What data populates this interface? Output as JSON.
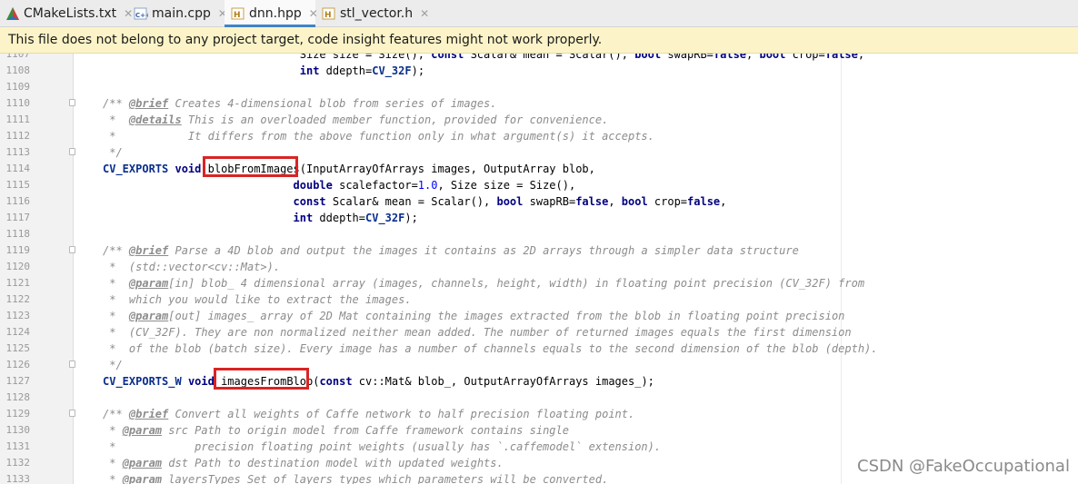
{
  "tabs": [
    {
      "label": "CMakeLists.txt",
      "icon": "cmake-triangle-icon",
      "active": false
    },
    {
      "label": "main.cpp",
      "icon": "cpp-file-icon",
      "active": false
    },
    {
      "label": "dnn.hpp",
      "icon": "header-file-icon",
      "active": true
    },
    {
      "label": "stl_vector.h",
      "icon": "header-file-icon",
      "active": false
    }
  ],
  "banner": {
    "text": "This file does not belong to any project target, code insight features might not work properly."
  },
  "lines": [
    {
      "num": "1107",
      "code": "                              Size size = Size(), const Scalar& mean = Scalar(), bool swapRB=false, bool crop=false,"
    },
    {
      "num": "1108",
      "code": "                              int ddepth=CV_32F);"
    },
    {
      "num": "1109",
      "code": ""
    },
    {
      "num": "1110",
      "code": "/** @brief Creates 4-dimensional blob from series of images."
    },
    {
      "num": "1111",
      "code": " *  @details This is an overloaded member function, provided for convenience."
    },
    {
      "num": "1112",
      "code": " *           It differs from the above function only in what argument(s) it accepts."
    },
    {
      "num": "1113",
      "code": " */"
    },
    {
      "num": "1114",
      "code": "CV_EXPORTS void blobFromImages(InputArrayOfArrays images, OutputArray blob,"
    },
    {
      "num": "1115",
      "code": "                             double scalefactor=1.0, Size size = Size(),"
    },
    {
      "num": "1116",
      "code": "                             const Scalar& mean = Scalar(), bool swapRB=false, bool crop=false,"
    },
    {
      "num": "1117",
      "code": "                             int ddepth=CV_32F);"
    },
    {
      "num": "1118",
      "code": ""
    },
    {
      "num": "1119",
      "code": "/** @brief Parse a 4D blob and output the images it contains as 2D arrays through a simpler data structure"
    },
    {
      "num": "1120",
      "code": " *  (std::vector<cv::Mat>)."
    },
    {
      "num": "1121",
      "code": " *  @param[in] blob_ 4 dimensional array (images, channels, height, width) in floating point precision (CV_32F) from"
    },
    {
      "num": "1122",
      "code": " *  which you would like to extract the images."
    },
    {
      "num": "1123",
      "code": " *  @param[out] images_ array of 2D Mat containing the images extracted from the blob in floating point precision"
    },
    {
      "num": "1124",
      "code": " *  (CV_32F). They are non normalized neither mean added. The number of returned images equals the first dimension"
    },
    {
      "num": "1125",
      "code": " *  of the blob (batch size). Every image has a number of channels equals to the second dimension of the blob (depth)."
    },
    {
      "num": "1126",
      "code": " */"
    },
    {
      "num": "1127",
      "code": "CV_EXPORTS_W void imagesFromBlob(const cv::Mat& blob_, OutputArrayOfArrays images_);"
    },
    {
      "num": "1128",
      "code": ""
    },
    {
      "num": "1129",
      "code": "/** @brief Convert all weights of Caffe network to half precision floating point."
    },
    {
      "num": "1130",
      "code": " * @param src Path to origin model from Caffe framework contains single"
    },
    {
      "num": "1131",
      "code": " *            precision floating point weights (usually has `.caffemodel` extension)."
    },
    {
      "num": "1132",
      "code": " * @param dst Path to destination model with updated weights."
    },
    {
      "num": "1133",
      "code": " * @param layersTypes Set of layers types which parameters will be converted."
    }
  ],
  "watermark": "CSDN @FakeOccupational",
  "colors": {
    "keyword": "#000080",
    "macro": "#0a2e8c",
    "number": "#0000ff",
    "comment": "#8c8c8c",
    "highlight": "#d92424",
    "banner": "#fcf4c8",
    "tab_accent": "#4083c9"
  }
}
